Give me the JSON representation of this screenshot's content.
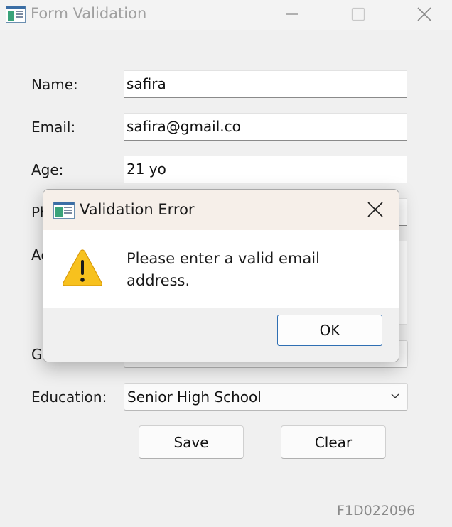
{
  "window": {
    "title": "Form Validation",
    "icons": {
      "app": "app-icon",
      "minimize": "minimize-icon",
      "maximize": "maximize-icon",
      "close": "close-icon"
    }
  },
  "form": {
    "name_label": "Name:",
    "name_value": "safira",
    "email_label": "Email:",
    "email_value": "safira@gmail.co",
    "age_label": "Age:",
    "age_value": "21 yo",
    "phone_label_partial": "Ph",
    "address_label_partial": "Ad",
    "gender_label_partial": "Ge",
    "education_label": "Education:",
    "education_value": "Senior High School",
    "save_label": "Save",
    "clear_label": "Clear"
  },
  "footer": {
    "code": "F1D022096"
  },
  "dialog": {
    "title": "Validation Error",
    "message": "Please enter a valid email address.",
    "ok_label": "OK",
    "icon": "warning-icon"
  },
  "colors": {
    "accent": "#2f6fb3",
    "warning": "#f7c11e",
    "window_bg": "#f0f0f0",
    "dialog_title_bg": "#f6efe9"
  }
}
